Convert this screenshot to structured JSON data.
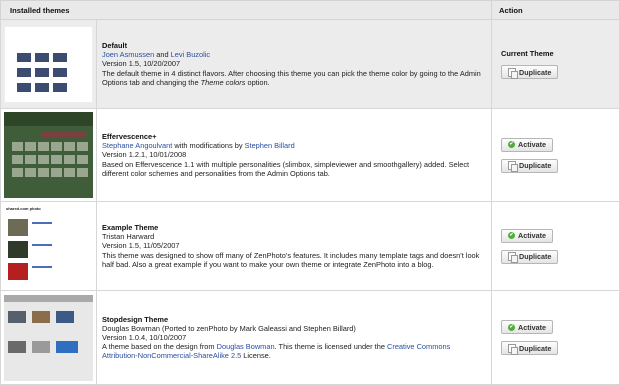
{
  "table": {
    "col_installed": "Installed themes",
    "col_action": "Action"
  },
  "labels": {
    "current_theme": "Current Theme",
    "activate": "Activate",
    "duplicate": "Duplicate",
    "and": "and",
    "with_mods": "with modifications by",
    "thumb3_title": "shared.com photo"
  },
  "themes": [
    {
      "name": "Default",
      "author_a": "Joen Asmussen",
      "author_b": "Levi Buzolic",
      "version": "Version 1.5, 10/20/2007",
      "desc_pre": "The default theme in 4 distinct flavors. After choosing this theme you can pick the theme color by going to the Admin Options tab and changing the ",
      "desc_em": "Theme colors",
      "desc_post": " option."
    },
    {
      "name": "Effervescence+",
      "author_a": "Stephane Angoulvant",
      "author_b": "Stephen Billard",
      "version": "Version 1.2.1, 10/01/2008",
      "desc": "Based on Effervescence 1.1 with multiple personalities (slimbox, simpleviewer and smoothgallery) added. Select different color schemes and personalities from the Admin Options tab."
    },
    {
      "name": "Example Theme",
      "author": "Tristan Harward",
      "version": "Version 1.5, 11/05/2007",
      "desc": "This theme was designed to show off many of ZenPhoto's features. It includes many template tags and doesn't look half bad. Also a great example if you want to make your own theme or integrate ZenPhoto into a blog."
    },
    {
      "name": "Stopdesign Theme",
      "author": "Douglas Bowman (Ported to zenPhoto by Mark Galeassi and Stephen Billard)",
      "version": "Version 1.0.4, 10/10/2007",
      "desc_pre": "A theme based on the design from ",
      "desc_link": "Douglas Bowman",
      "desc_mid": ". This theme is licensed under the ",
      "desc_link2": "Creative Commons Attribution-NonCommercial-ShareAlike 2.5",
      "desc_post": " License."
    }
  ]
}
